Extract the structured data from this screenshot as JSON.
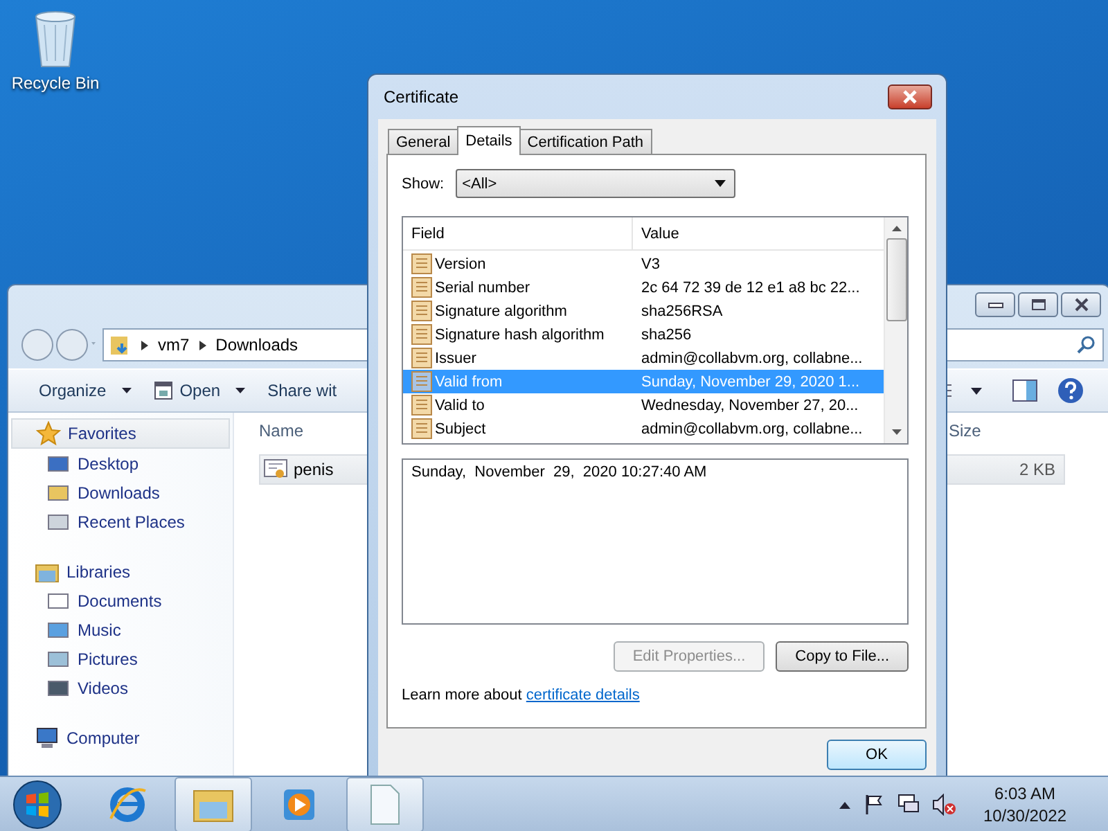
{
  "desktop_icons": [
    {
      "label": "Recycle Bin"
    }
  ],
  "explorer": {
    "address": [
      "vm7",
      "Downloads"
    ],
    "toolbar": [
      {
        "label": "Organize",
        "caret": true
      },
      {
        "label": "Open",
        "caret": true
      },
      {
        "label": "Share wit",
        "caret": false
      }
    ],
    "nav": [
      {
        "label": "Favorites",
        "highlighted": true,
        "items": [
          "Desktop",
          "Downloads",
          "Recent Places"
        ]
      },
      {
        "label": "Libraries",
        "highlighted": false,
        "items": [
          "Documents",
          "Music",
          "Pictures",
          "Videos"
        ]
      },
      {
        "label": "Computer",
        "highlighted": false
      }
    ],
    "columns": [
      "Name",
      "Size"
    ],
    "files": [
      {
        "name": "penis",
        "size": "2 KB",
        "selected": true
      }
    ]
  },
  "dialog": {
    "title": "Certificate",
    "tabs": [
      {
        "label": "General",
        "selected": false
      },
      {
        "label": "Details",
        "selected": true
      },
      {
        "label": "Certification Path",
        "selected": false
      }
    ],
    "show_label": "Show:",
    "show_value": "<All>",
    "columns": [
      "Field",
      "Value"
    ],
    "rows": [
      {
        "field": "Version",
        "value": "V3",
        "selected": false
      },
      {
        "field": "Serial number",
        "value": "2c 64 72 39 de 12 e1 a8 bc 22...",
        "selected": false
      },
      {
        "field": "Signature algorithm",
        "value": "sha256RSA",
        "selected": false
      },
      {
        "field": "Signature hash algorithm",
        "value": "sha256",
        "selected": false
      },
      {
        "field": "Issuer",
        "value": "admin@collabvm.org, collabne...",
        "selected": false
      },
      {
        "field": "Valid from",
        "value": "Sunday, November 29, 2020 1...",
        "selected": true
      },
      {
        "field": "Valid to",
        "value": "Wednesday, November 27, 20...",
        "selected": false
      },
      {
        "field": "Subject",
        "value": "admin@collabvm.org, collabne...",
        "selected": false
      }
    ],
    "detail_text": "Sunday,  November  29,  2020 10:27:40 AM",
    "buttons": [
      {
        "label": "Edit Properties...",
        "disabled": true
      },
      {
        "label": "Copy to File...",
        "disabled": false
      }
    ],
    "learn_more": {
      "text": "Learn more about",
      "link": "certificate details"
    },
    "ok_label": "OK"
  },
  "taskbar": {
    "items": [
      {
        "kind": "browser",
        "active": false
      },
      {
        "kind": "folder",
        "active": true
      },
      {
        "kind": "media",
        "active": false
      },
      {
        "kind": "document",
        "active": true
      }
    ],
    "time": "6:03 AM",
    "date": "10/30/2022"
  }
}
